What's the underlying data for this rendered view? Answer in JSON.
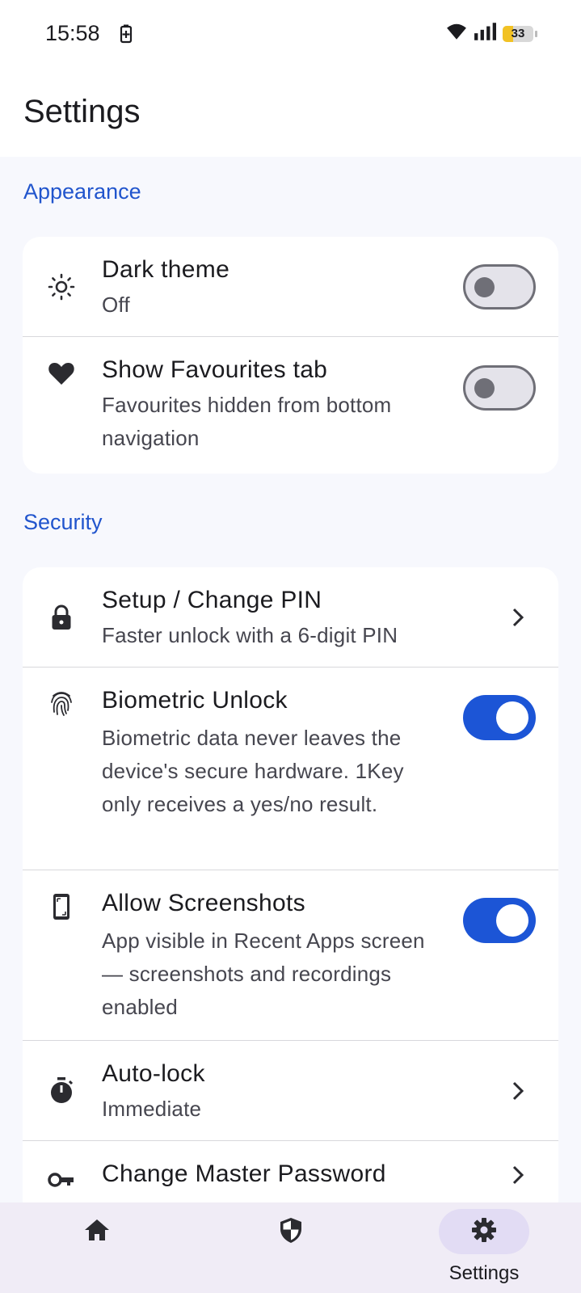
{
  "status_bar": {
    "time": "15:58",
    "battery_level": "33",
    "battery_fraction": 0.33,
    "icons": [
      "battery-saver-icon",
      "wifi-icon",
      "signal-icon",
      "battery-icon"
    ]
  },
  "header": {
    "title": "Settings"
  },
  "sections": [
    {
      "title": "Appearance",
      "items": [
        {
          "title": "Dark theme",
          "subtitle": "Off",
          "icon": "brightness-icon",
          "control": "toggle",
          "checked": false
        },
        {
          "title": "Show Favourites tab",
          "subtitle": "Favourites hidden from bottom navigation",
          "icon": "heart-icon",
          "control": "toggle",
          "checked": false
        }
      ]
    },
    {
      "title": "Security",
      "items": [
        {
          "title": "Setup / Change PIN",
          "subtitle": "Faster unlock with a 6-digit PIN",
          "icon": "lock-icon",
          "control": "chevron"
        },
        {
          "title": "Biometric Unlock",
          "subtitle": "Biometric data never leaves the device's secure hardware. 1Key only receives a yes/no result.",
          "icon": "fingerprint-icon",
          "control": "toggle",
          "checked": true
        },
        {
          "title": "Allow Screenshots",
          "subtitle": "App visible in Recent Apps screen — screenshots and recordings enabled",
          "icon": "screenshot-icon",
          "control": "toggle",
          "checked": true
        },
        {
          "title": "Auto-lock",
          "subtitle": "Immediate",
          "icon": "timer-icon",
          "control": "chevron"
        },
        {
          "title": "Change Master Password",
          "subtitle": "",
          "icon": "key-icon",
          "control": "chevron"
        }
      ]
    }
  ],
  "bottom_nav": {
    "items": [
      {
        "label": "",
        "icon": "home-icon",
        "active": false
      },
      {
        "label": "",
        "icon": "shield-icon",
        "active": false
      },
      {
        "label": "Settings",
        "icon": "gear-icon",
        "active": true
      }
    ]
  },
  "colors": {
    "accent": "#1c55d6",
    "section_header": "#2155cd",
    "background": "#f7f8fd",
    "nav_background": "#f0ecf6",
    "nav_active_pill": "#e2dcf4"
  }
}
